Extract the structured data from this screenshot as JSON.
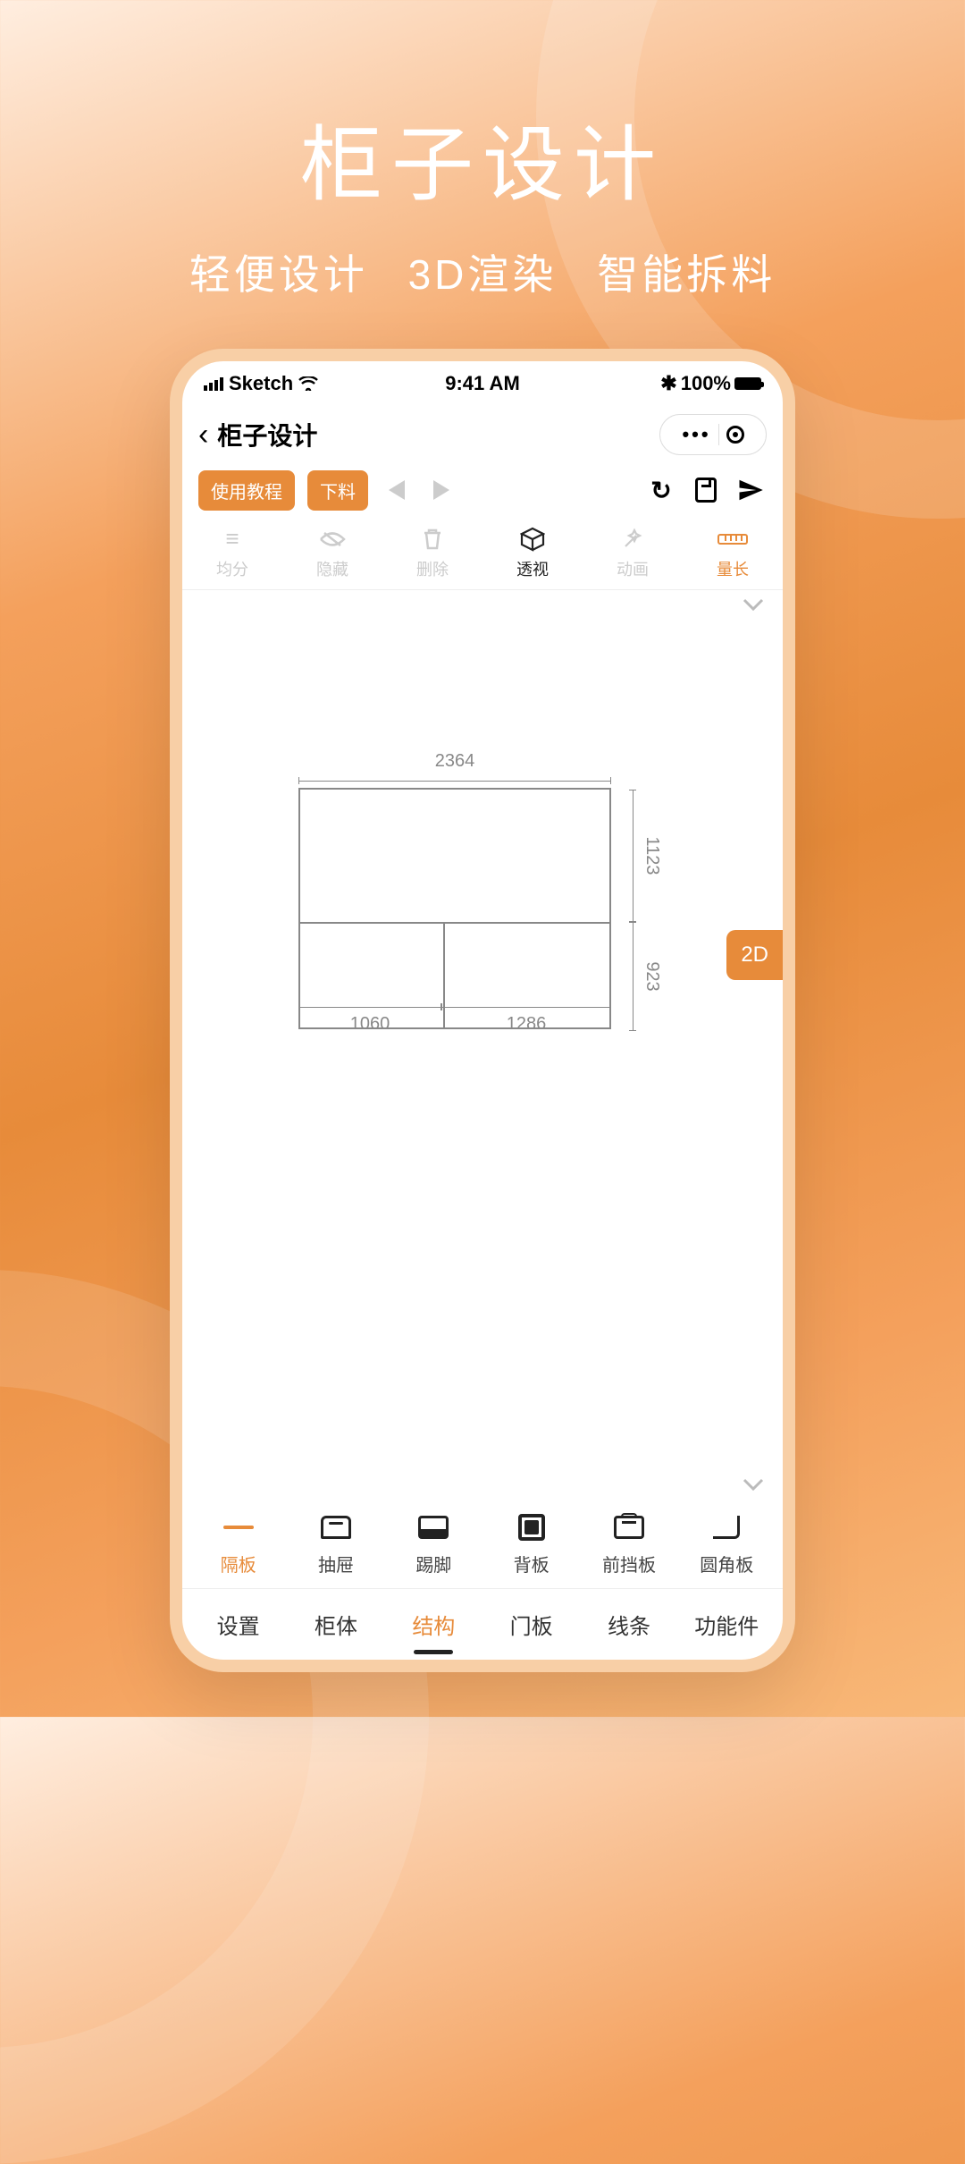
{
  "hero": {
    "title": "柜子设计",
    "tag1": "轻便设计",
    "tag2": "3D渲染",
    "tag3": "智能拆料"
  },
  "statusbar": {
    "carrier": "Sketch",
    "time": "9:41 AM",
    "battery": "100%"
  },
  "nav": {
    "title": "柜子设计"
  },
  "actions": {
    "tutorial": "使用教程",
    "cutlist": "下料"
  },
  "tool_tabs": [
    {
      "label": "均分"
    },
    {
      "label": "隐藏"
    },
    {
      "label": "删除"
    },
    {
      "label": "透视"
    },
    {
      "label": "动画"
    },
    {
      "label": "量长"
    }
  ],
  "canvas": {
    "dims": {
      "width_total": "2364",
      "height_top": "1123",
      "height_bottom": "923",
      "width_left": "1060",
      "width_right": "1286"
    },
    "view_mode": "2D"
  },
  "components": [
    {
      "label": "隔板"
    },
    {
      "label": "抽屉"
    },
    {
      "label": "踢脚"
    },
    {
      "label": "背板"
    },
    {
      "label": "前挡板"
    },
    {
      "label": "圆角板"
    }
  ],
  "bottom_tabs": [
    {
      "label": "设置"
    },
    {
      "label": "柜体"
    },
    {
      "label": "结构"
    },
    {
      "label": "门板"
    },
    {
      "label": "线条"
    },
    {
      "label": "功能件"
    }
  ]
}
